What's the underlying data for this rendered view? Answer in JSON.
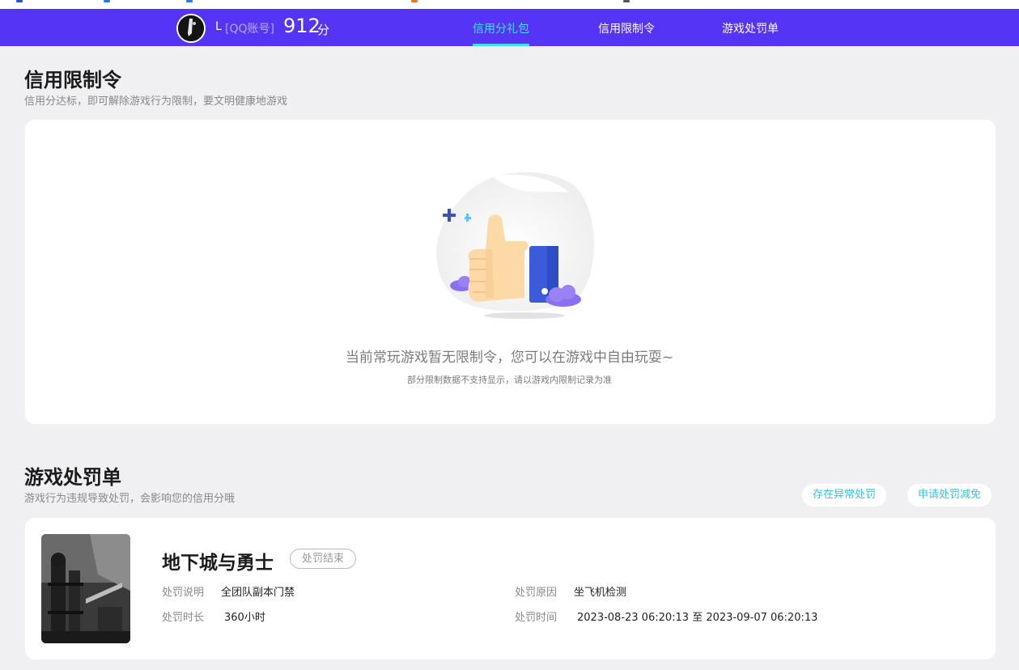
{
  "header": {
    "user_name": "L",
    "account_type": "[QQ账号]",
    "score": "912",
    "score_unit": "分",
    "tabs": [
      {
        "label": "信用分礼包",
        "active": true
      },
      {
        "label": "信用限制令",
        "active": false
      },
      {
        "label": "游戏处罚单",
        "active": false
      }
    ]
  },
  "restriction": {
    "title": "信用限制令",
    "subtitle": "信用分达标，即可解除游戏行为限制，要文明健康地游戏",
    "empty_message": "当前常玩游戏暂无限制令，您可以在游戏中自由玩耍~",
    "empty_note": "部分限制数据不支持显示，请以游戏内限制记录为准"
  },
  "penalty": {
    "title": "游戏处罚单",
    "subtitle": "游戏行为违规导致处罚，会影响您的信用分哦",
    "abnormal_button": "存在异常处罚",
    "appeal_button": "申请处罚减免",
    "record": {
      "game_name": "地下城与勇士",
      "status": "处罚结束",
      "desc_label": "处罚说明",
      "desc_value": "全团队副本门禁",
      "reason_label": "处罚原因",
      "reason_value": "坐飞机检测",
      "duration_label": "处罚时长",
      "duration_value": "360小时",
      "time_label": "处罚时间",
      "time_value": "2023-08-23 06:20:13 至 2023-09-07 06:20:13"
    }
  },
  "colors": {
    "nav_bg": "#5534f5",
    "active_tab": "#3ee1f0",
    "page_bg": "#f0f0f2",
    "link": "#3dbedd"
  }
}
